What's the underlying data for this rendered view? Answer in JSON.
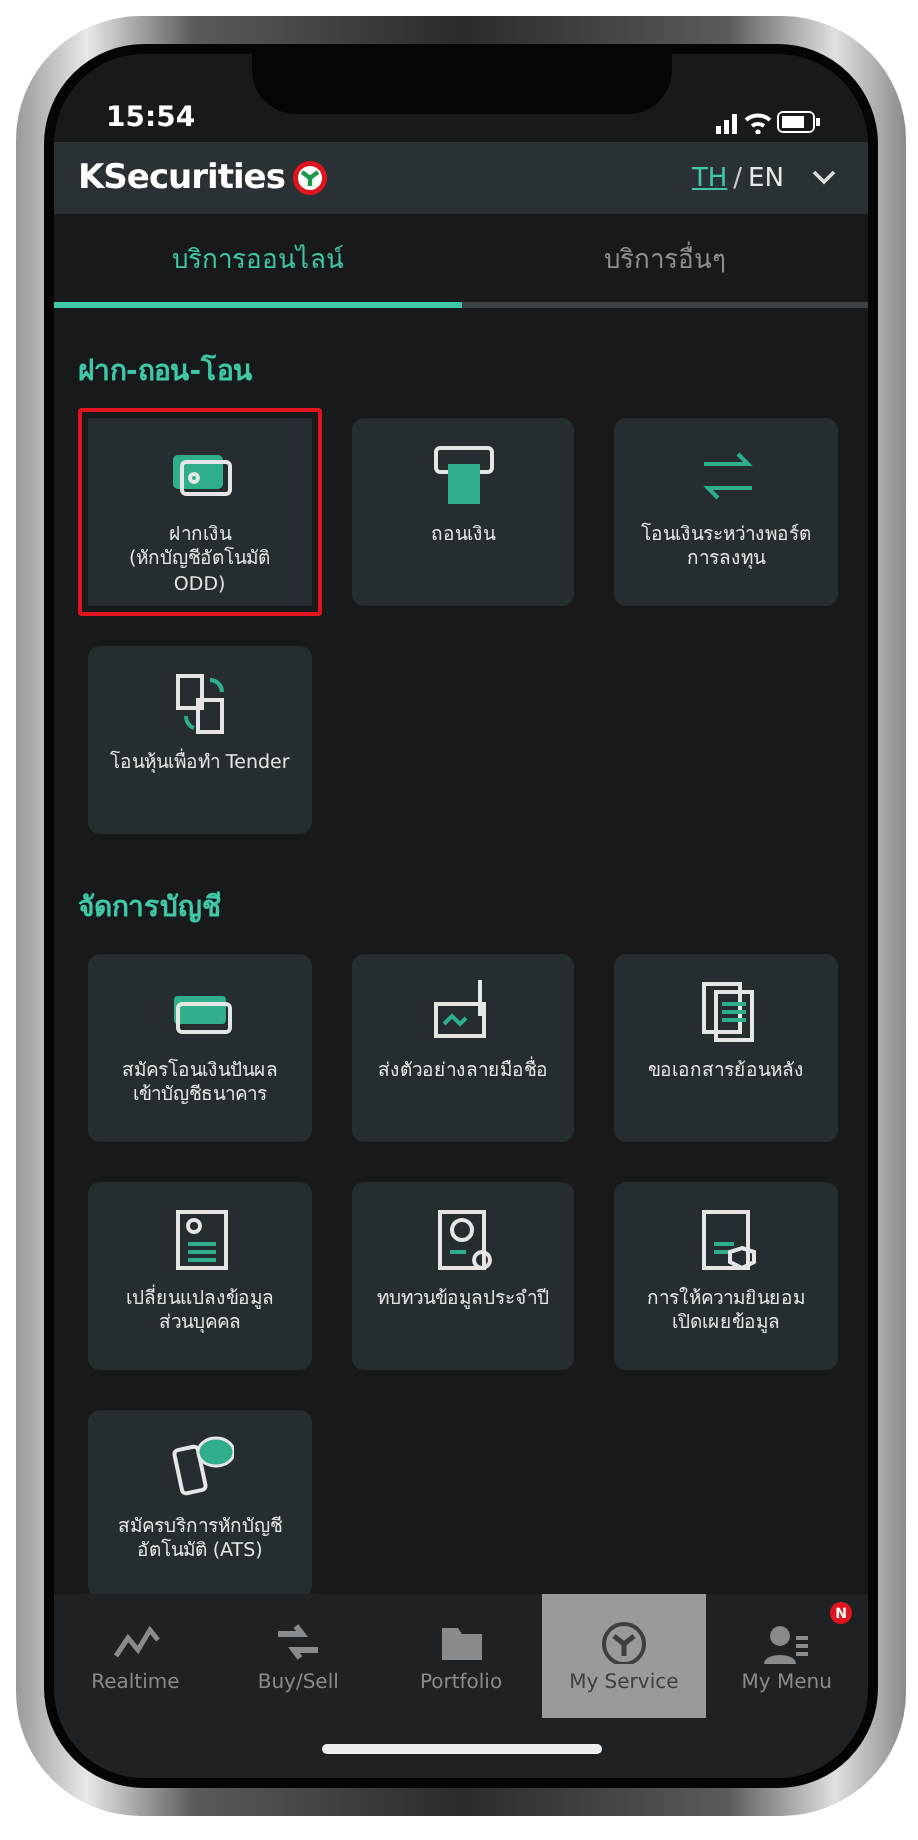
{
  "status_bar": {
    "time": "15:54"
  },
  "header": {
    "brand": "KSecurities",
    "languages": [
      {
        "label": "TH",
        "selected": true
      },
      {
        "label": "EN",
        "selected": false
      }
    ],
    "separator": "/"
  },
  "tabs": [
    {
      "label": "บริการออนไลน์",
      "selected": true
    },
    {
      "label": "บริการอื่นๆ",
      "selected": false
    }
  ],
  "sections": [
    {
      "title": "ฝาก-ถอน-โอน",
      "items": [
        {
          "lines": [
            "ฝากเงิน",
            "(หักบัญชีอัตโนมัติ",
            "ODD)"
          ],
          "highlighted": true
        },
        {
          "lines": [
            "ถอนเงิน"
          ],
          "highlighted": false
        },
        {
          "lines": [
            "โอนเงินระหว่างพอร์ต",
            "การลงทุน"
          ],
          "highlighted": false
        },
        {
          "lines": [
            "โอนหุ้นเพื่อทำ Tender"
          ],
          "highlighted": false
        }
      ]
    },
    {
      "title": "จัดการบัญชี",
      "items": [
        {
          "lines": [
            "สมัครโอนเงินปันผล",
            "เข้าบัญชีธนาคาร"
          ],
          "highlighted": false
        },
        {
          "lines": [
            "ส่งตัวอย่างลายมือชื่อ"
          ],
          "highlighted": false
        },
        {
          "lines": [
            "ขอเอกสารย้อนหลัง"
          ],
          "highlighted": false
        },
        {
          "lines": [
            "เปลี่ยนแปลงข้อมูล",
            "ส่วนบุคคล"
          ],
          "highlighted": false
        },
        {
          "lines": [
            "ทบทวนข้อมูลประจำปี"
          ],
          "highlighted": false
        },
        {
          "lines": [
            "การให้ความยินยอม",
            "เปิดเผยข้อมูล"
          ],
          "highlighted": false
        },
        {
          "lines": [
            "สมัครบริการหักบัญชี",
            "อัตโนมัติ (ATS)"
          ],
          "highlighted": false
        }
      ]
    }
  ],
  "bottom_nav": [
    {
      "label": "Realtime",
      "selected": false
    },
    {
      "label": "Buy/Sell",
      "selected": false
    },
    {
      "label": "Portfolio",
      "selected": false
    },
    {
      "label": "My Service",
      "selected": true
    },
    {
      "label": "My Menu",
      "selected": false,
      "badge": "N"
    }
  ]
}
